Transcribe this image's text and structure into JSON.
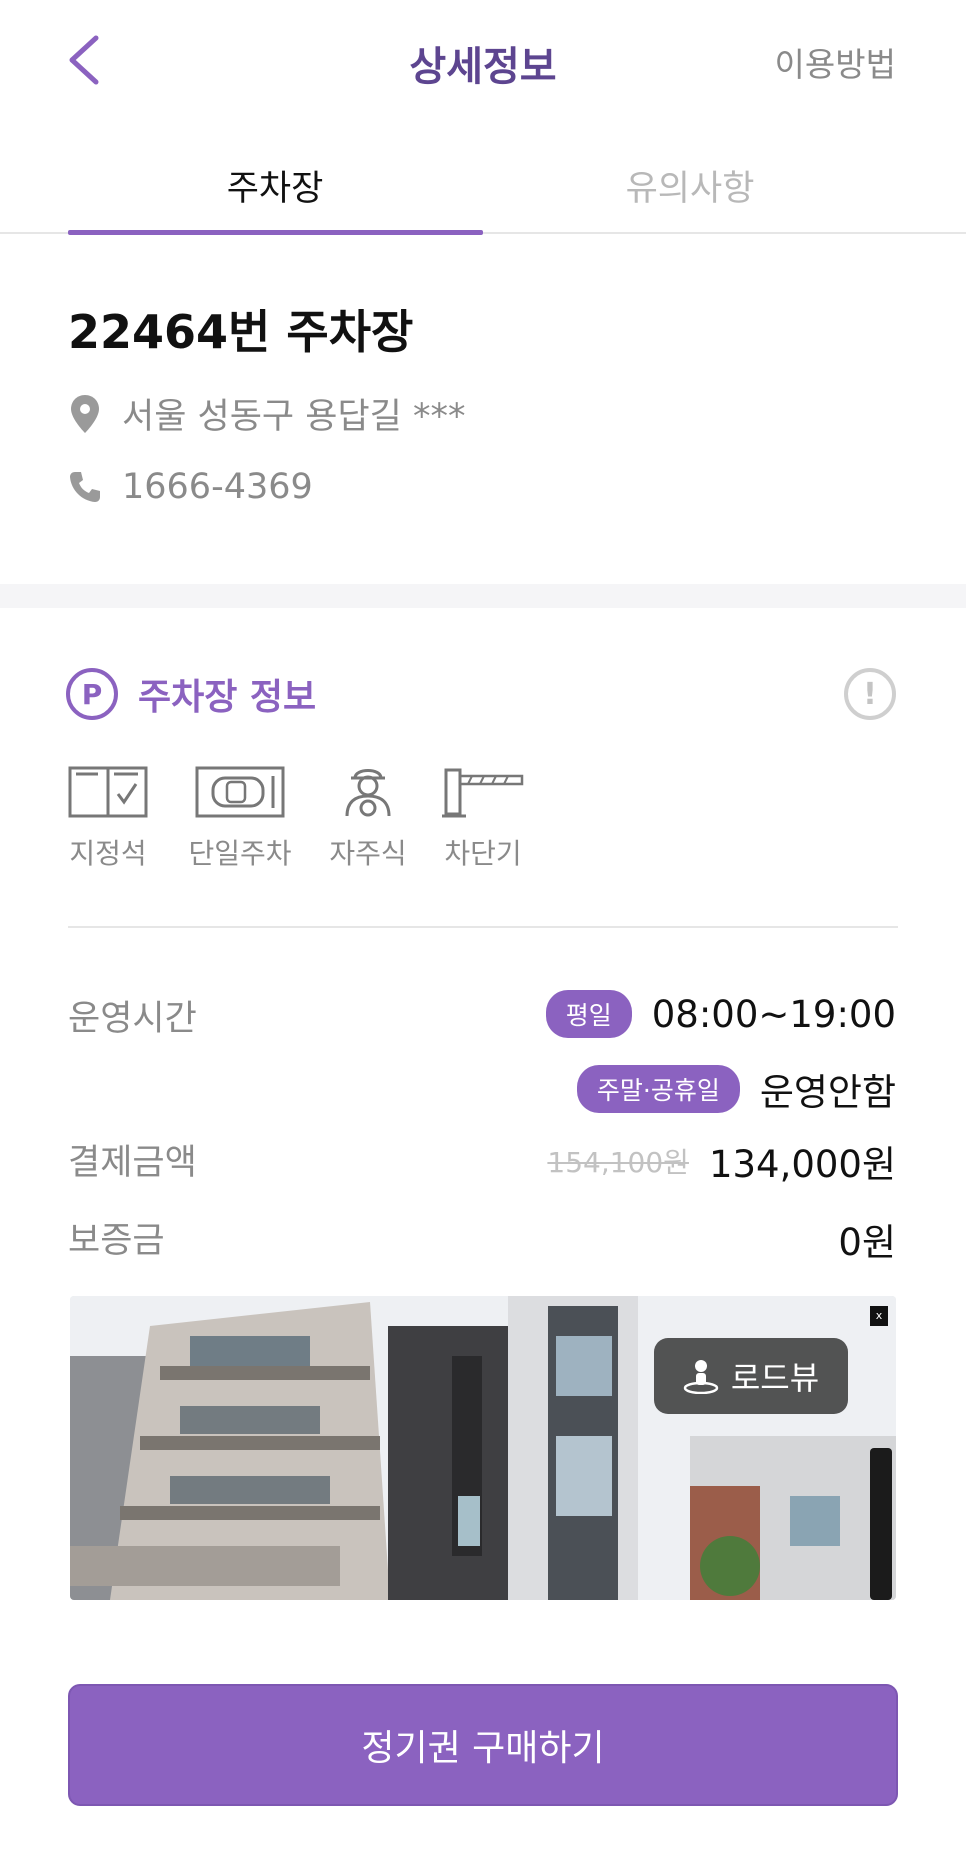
{
  "header": {
    "title": "상세정보",
    "help_label": "이용방법",
    "back_icon": "chevron-left-icon"
  },
  "tabs": [
    {
      "label": "주차장",
      "active": true
    },
    {
      "label": "유의사항",
      "active": false
    }
  ],
  "lot": {
    "name": "22464번 주차장",
    "address": "서울 성동구 용답길 ***",
    "phone": "1666-4369"
  },
  "section": {
    "title": "주차장 정보",
    "p_letter": "P",
    "notice_glyph": "!"
  },
  "features": [
    {
      "label": "지정석",
      "icon": "reserved-spot-icon"
    },
    {
      "label": "단일주차",
      "icon": "single-parking-icon"
    },
    {
      "label": "자주식",
      "icon": "self-park-driver-icon"
    },
    {
      "label": "차단기",
      "icon": "barrier-gate-icon"
    }
  ],
  "details": {
    "hours_label": "운영시간",
    "weekday_badge": "평일",
    "weekday_hours": "08:00~19:00",
    "weekend_badge": "주말·공휴일",
    "weekend_hours": "운영안함",
    "price_label": "결제금액",
    "price_original": "154,100원",
    "price_current": "134,000원",
    "deposit_label": "보증금",
    "deposit_value": "0원"
  },
  "roadview": {
    "button_label": "로드뷰",
    "close_label": "x"
  },
  "cta": {
    "label": "정기권 구매하기"
  },
  "colors": {
    "accent": "#8b62c0",
    "title": "#5d4590",
    "muted": "#8a8a8a"
  }
}
